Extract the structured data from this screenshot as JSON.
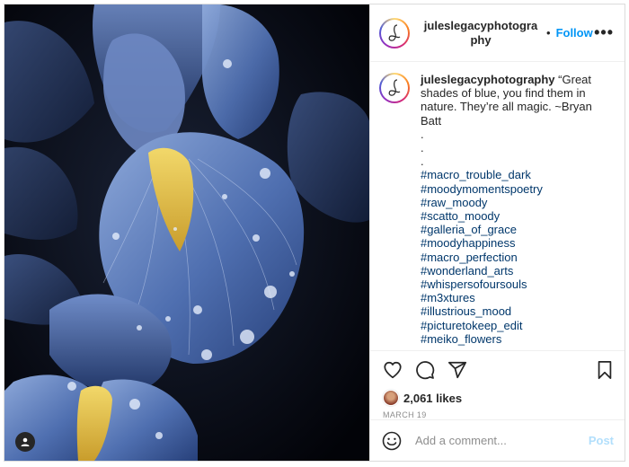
{
  "post": {
    "photo_alt": "Blue iris flower with water droplets",
    "header": {
      "username": "juleslegacyphotography",
      "separator": "•",
      "follow_label": "Follow",
      "more_icon": "more-horizontal-icon"
    },
    "caption": {
      "username": "juleslegacyphotography",
      "text": "“Great shades of blue, you find them in nature. They’re all magic. ~Bryan Batt",
      "dots": [
        ".",
        ".",
        "."
      ],
      "hashtags": [
        "#macro_trouble_dark",
        "#moodymomentspoetry",
        "#raw_moody",
        "#scatto_moody",
        "#galleria_of_grace",
        "#moodyhappiness",
        "#macro_perfection",
        "#wonderland_arts",
        "#whispersofoursouls",
        "#m3xtures",
        "#illustrious_mood",
        "#picturetokeep_edit",
        "#meiko_flowers"
      ]
    },
    "actions": [
      "heart-icon",
      "comment-icon",
      "share-icon",
      "bookmark-icon"
    ],
    "likes": "2,061 likes",
    "date": "MARCH 19",
    "comment": {
      "placeholder": "Add a comment...",
      "post_label": "Post"
    }
  },
  "colors": {
    "accent": "#0095f6",
    "hashtag": "#00376b",
    "post_disabled": "#b2dffc",
    "muted": "#8e8e8e"
  }
}
